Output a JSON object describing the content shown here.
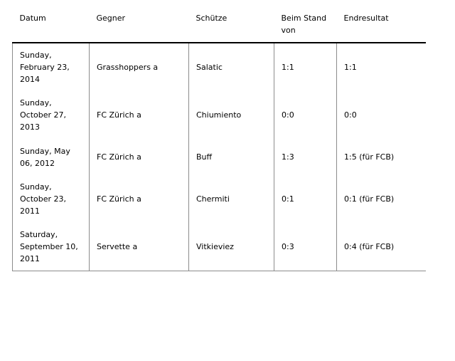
{
  "table": {
    "columns": [
      {
        "key": "datum",
        "label": "Datum"
      },
      {
        "key": "gegner",
        "label": "Gegner"
      },
      {
        "key": "schuetze",
        "label": "Schütze"
      },
      {
        "key": "stand",
        "label": "Beim Stand von"
      },
      {
        "key": "endresultat",
        "label": "Endresultat"
      }
    ],
    "rows": [
      {
        "datum": "Sunday, February 23, 2014",
        "gegner": "Grasshoppers a",
        "schuetze": "Salatic",
        "stand": "1:1",
        "endresultat": "1:1"
      },
      {
        "datum": "Sunday, October 27, 2013",
        "gegner": "FC Zürich a",
        "schuetze": "Chiumiento",
        "stand": "0:0",
        "endresultat": "0:0"
      },
      {
        "datum": "Sunday, May 06, 2012",
        "gegner": "FC Zürich a",
        "schuetze": "Buff",
        "stand": "1:3",
        "endresultat": "1:5 (für FCB)"
      },
      {
        "datum": "Sunday, October 23, 2011",
        "gegner": "FC Zürich a",
        "schuetze": "Chermiti",
        "stand": "0:1",
        "endresultat": "0:1 (für FCB)"
      },
      {
        "datum": "Saturday, September 10, 2011",
        "gegner": "Servette a",
        "schuetze": "Vitkieviez",
        "stand": "0:3",
        "endresultat": "0:4 (für FCB)"
      }
    ]
  },
  "colors": {
    "text": "#000000",
    "rule_strong": "#000000",
    "rule_light": "#8c8c8c",
    "background": "#ffffff"
  }
}
